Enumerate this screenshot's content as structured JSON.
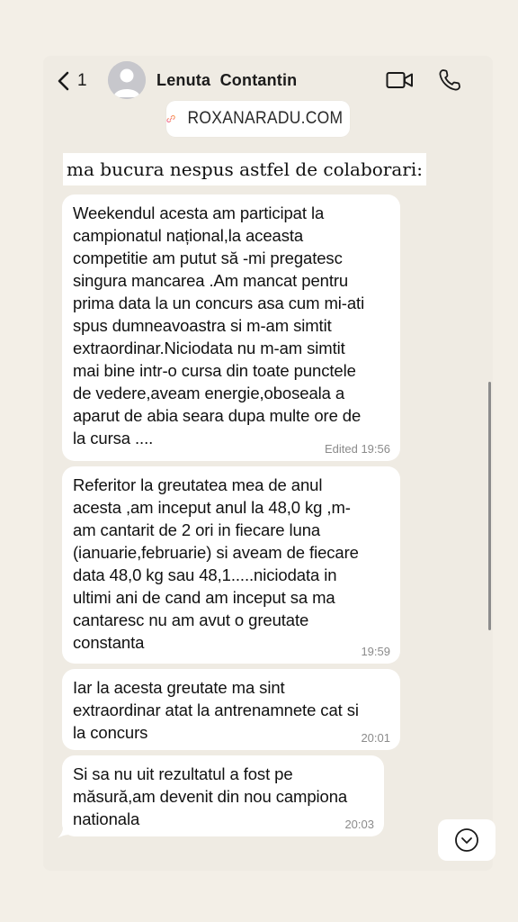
{
  "header": {
    "back_count": "1",
    "contact_name": "Lenuta  Contantin"
  },
  "watermark": {
    "text": "ROXANARADU.COM",
    "icon": "link-icon"
  },
  "caption": "ma bucura nespus astfel de colaborari:",
  "messages": [
    {
      "text": "Weekendul acesta am participat la\ncampionatul național,la aceasta\ncompetitie am putut să -mi pregatesc\nsingura mancarea .Am mancat pentru\nprima data la un concurs asa cum mi-ati\nspus dumneavoastra si m-am simtit\nextraordinar.Niciodata nu m-am simtit\nmai bine intr-o cursa din toate punctele\nde vedere,aveam energie,oboseala a\naparut de abia seara dupa multe ore de\nla cursa ....",
      "time": "Edited 19:56"
    },
    {
      "text": "Referitor la greutatea mea de anul\nacesta ,am inceput anul la 48,0 kg ,m-\nam cantarit de 2 ori in fiecare luna\n(ianuarie,februarie) si aveam de fiecare\ndata 48,0 kg sau 48,1.....niciodata in\nultimi ani de cand am inceput sa ma\ncantaresc nu am avut o greutate\nconstanta",
      "time": "19:59"
    },
    {
      "text": "Iar la acesta greutate ma sint\nextraordinar atat la antrenamnete cat si\nla concurs",
      "time": "20:01"
    },
    {
      "text": "Si sa nu uit rezultatul a fost pe\nmăsură,am devenit din nou campiona\nnationala",
      "time": "20:03"
    }
  ],
  "colors": {
    "background": "#efebe3",
    "bubble": "#ffffff",
    "watermark_gradient_start": "#f15a9c",
    "watermark_gradient_end": "#f7a13b"
  },
  "icons": {
    "back": "chevron-left-icon",
    "avatar": "avatar-placeholder-icon",
    "video": "video-camera-icon",
    "call": "phone-icon",
    "scroll": "chevron-down-circle-icon"
  }
}
